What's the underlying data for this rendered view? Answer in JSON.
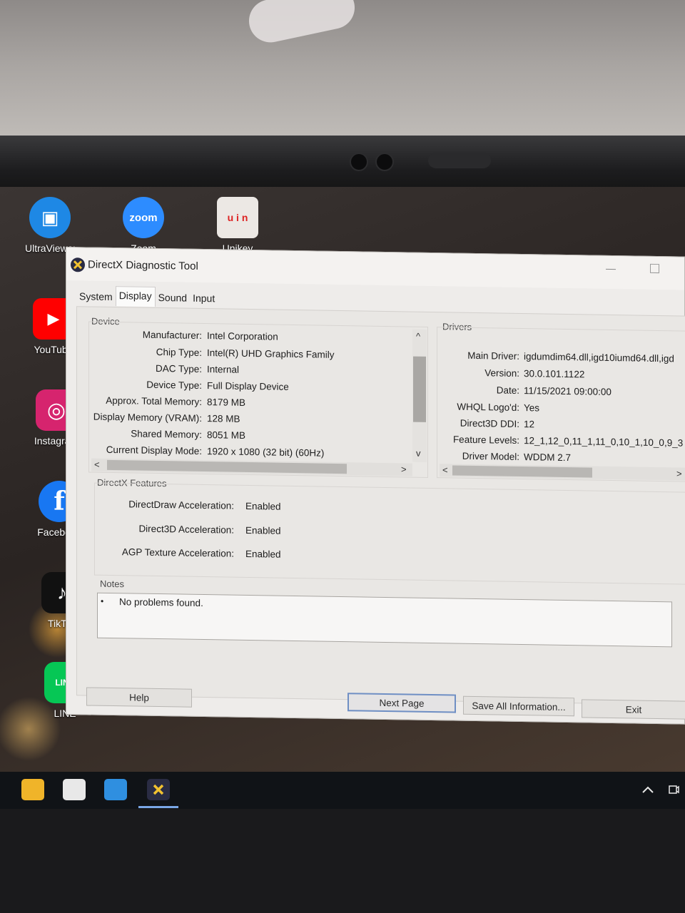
{
  "window": {
    "title": "DirectX Diagnostic Tool",
    "tabs": [
      {
        "label": "System"
      },
      {
        "label": "Display"
      },
      {
        "label": "Sound"
      },
      {
        "label": "Input"
      }
    ]
  },
  "device": {
    "title": "Device",
    "rows": [
      {
        "key": "Manufacturer:",
        "value": "Intel Corporation"
      },
      {
        "key": "Chip Type:",
        "value": "Intel(R) UHD Graphics Family"
      },
      {
        "key": "DAC Type:",
        "value": "Internal"
      },
      {
        "key": "Device Type:",
        "value": "Full Display Device"
      },
      {
        "key": "Approx. Total Memory:",
        "value": "8179 MB"
      },
      {
        "key": "Display Memory (VRAM):",
        "value": "128 MB"
      },
      {
        "key": "Shared Memory:",
        "value": "8051 MB"
      },
      {
        "key": "Current Display Mode:",
        "value": "1920 x 1080 (32 bit) (60Hz)"
      }
    ]
  },
  "drivers": {
    "title": "Drivers",
    "rows": [
      {
        "key": "Main Driver:",
        "value": "igdumdim64.dll,igd10iumd64.dll,igd"
      },
      {
        "key": "Version:",
        "value": "30.0.101.1122"
      },
      {
        "key": "Date:",
        "value": "11/15/2021 09:00:00"
      },
      {
        "key": "WHQL Logo'd:",
        "value": "Yes"
      },
      {
        "key": "Direct3D DDI:",
        "value": "12"
      },
      {
        "key": "Feature Levels:",
        "value": "12_1,12_0,11_1,11_0,10_1,10_0,9_3"
      },
      {
        "key": "Driver Model:",
        "value": "WDDM 2.7"
      }
    ]
  },
  "features": {
    "title": "DirectX Features",
    "rows": [
      {
        "key": "DirectDraw Acceleration:",
        "value": "Enabled"
      },
      {
        "key": "Direct3D Acceleration:",
        "value": "Enabled"
      },
      {
        "key": "AGP Texture Acceleration:",
        "value": "Enabled"
      }
    ]
  },
  "notes": {
    "title": "Notes",
    "bullet": "•",
    "items": [
      "No problems found."
    ]
  },
  "buttons": {
    "help": "Help",
    "next_page": "Next Page",
    "save_all": "Save All Information...",
    "exit": "Exit"
  },
  "scroll_arrows": {
    "up": "^",
    "down": "v",
    "left": "<",
    "right": ">"
  },
  "desktop_icons": [
    {
      "label": "UltraViewer",
      "glyph": "▣",
      "color": "#1e88e5"
    },
    {
      "label": "Zoom",
      "glyph": "zoom",
      "color": "#2d8cff"
    },
    {
      "label": "Unikey",
      "glyph": "u i n",
      "color": "#ece8e4"
    },
    {
      "label": "YouTube",
      "glyph": "▶",
      "color": "#ff0000"
    },
    {
      "label": "Instagram",
      "glyph": "◎",
      "color": "#d6246e"
    },
    {
      "label": "Facebook",
      "glyph": "f",
      "color": "#1877f2"
    },
    {
      "label": "TikTok",
      "glyph": "♪",
      "color": "#111111"
    },
    {
      "label": "LINE",
      "glyph": "LINE",
      "color": "#06c755"
    }
  ]
}
